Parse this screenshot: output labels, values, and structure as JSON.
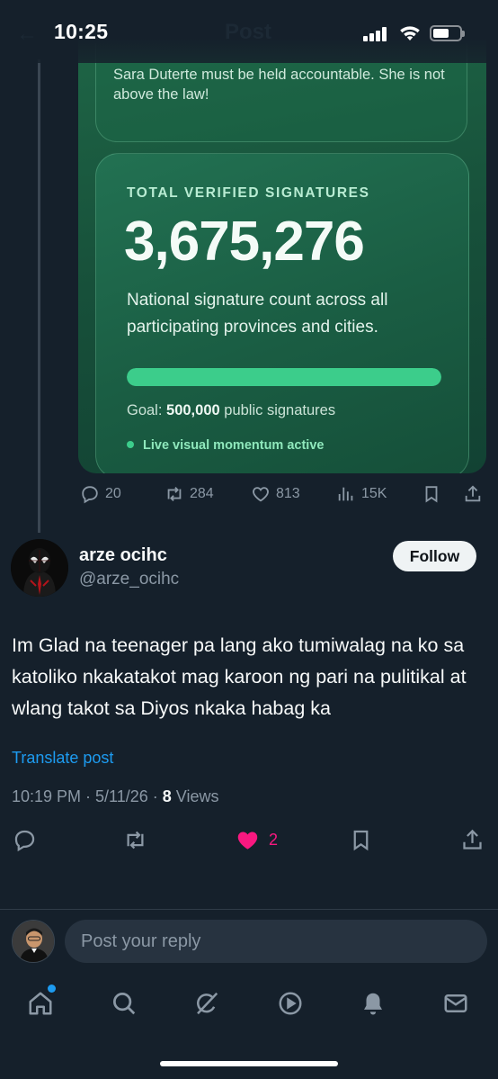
{
  "status_bar": {
    "time": "10:25"
  },
  "header": {
    "title": "Post"
  },
  "embedded_card": {
    "quote_text": "Sara Duterte must be held accountable. She is not above the law!",
    "stats_label": "TOTAL VERIFIED SIGNATURES",
    "stats_number": "3,675,276",
    "description": "National signature count across all participating provinces and cities.",
    "progress_fraction": 1.0,
    "goal_prefix": "Goal: ",
    "goal_value": "500,000",
    "goal_suffix": " public signatures",
    "live_text": "Live visual momentum active"
  },
  "parent_actions": {
    "replies": "20",
    "reposts": "284",
    "likes": "813",
    "views": "15K"
  },
  "post": {
    "display_name": "arze ocihc",
    "handle": "@arze_ocihc",
    "follow_label": "Follow",
    "text": "Im Glad na teenager pa lang ako tumiwalag na ko sa katoliko nkakatakot mag karoon ng pari na pulitikal at wlang takot sa Diyos nkaka habag ka",
    "translate_label": "Translate post",
    "meta_prefix": "10:19 PM · 5/11/26 · ",
    "views_count": "8",
    "views_label": " Views"
  },
  "post_actions": {
    "likes": "2"
  },
  "reply": {
    "placeholder": "Post your reply"
  },
  "colors": {
    "accent": "#1d9bf0",
    "like": "#f91880",
    "card_green": "#1e6546",
    "progress": "#3ccd8b"
  },
  "icons": {
    "parent": [
      "reply-icon",
      "repost-icon",
      "like-icon",
      "views-icon",
      "bookmark-icon",
      "share-icon"
    ],
    "main": [
      "reply-icon",
      "repost-icon",
      "liked-heart-icon",
      "bookmark-icon",
      "share-icon"
    ],
    "nav": [
      "home-icon",
      "search-icon",
      "grok-icon",
      "video-icon",
      "notifications-icon",
      "messages-icon"
    ]
  }
}
